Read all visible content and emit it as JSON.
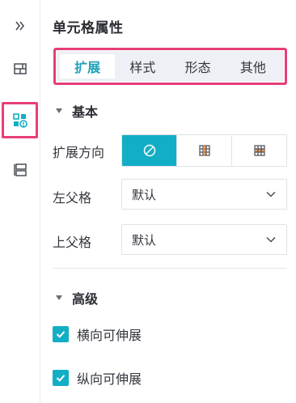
{
  "colors": {
    "accent": "#12aec5",
    "active_tab_text": "#1ea1b7",
    "highlight_frame": "#e83e78",
    "tab_bar_bg": "#edf0f5"
  },
  "rail": {
    "items": [
      {
        "name": "collapse",
        "icon": "double-chevron-right-icon"
      },
      {
        "name": "layout",
        "icon": "layout-grid-icon"
      },
      {
        "name": "cell-properties",
        "icon": "cell-properties-icon",
        "selected": true
      },
      {
        "name": "widget",
        "icon": "widget-icon"
      }
    ]
  },
  "panel": {
    "title": "单元格属性",
    "tabs": [
      {
        "label": "扩展",
        "active": true
      },
      {
        "label": "样式",
        "active": false
      },
      {
        "label": "形态",
        "active": false
      },
      {
        "label": "其他",
        "active": false
      }
    ],
    "basic": {
      "header": "基本",
      "expand_direction": {
        "label": "扩展方向",
        "options": [
          {
            "icon": "no-expand-icon",
            "selected": true
          },
          {
            "icon": "vertical-expand-icon",
            "selected": false
          },
          {
            "icon": "horizontal-expand-icon",
            "selected": false
          }
        ]
      },
      "left_parent": {
        "label": "左父格",
        "value": "默认"
      },
      "up_parent": {
        "label": "上父格",
        "value": "默认"
      }
    },
    "advanced": {
      "header": "高级",
      "checkboxes": [
        {
          "label": "横向可伸展",
          "checked": true
        },
        {
          "label": "纵向可伸展",
          "checked": true
        }
      ]
    }
  }
}
